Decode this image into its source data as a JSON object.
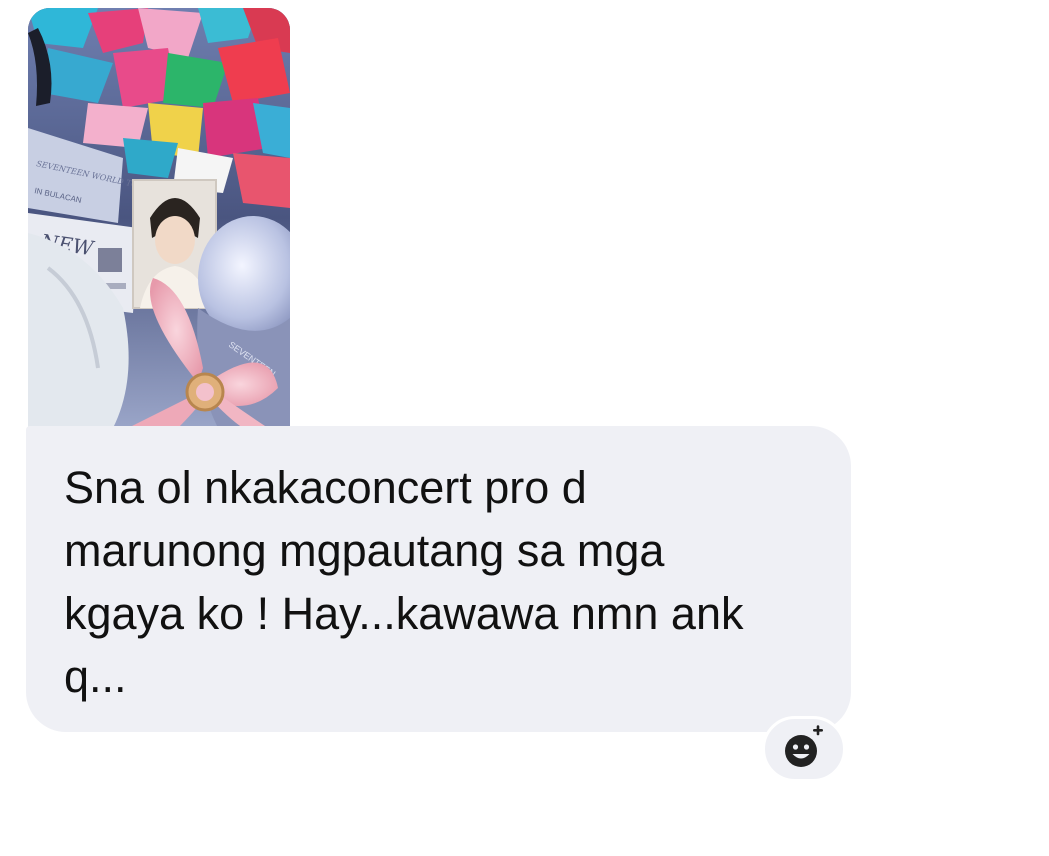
{
  "message": {
    "text": "Sna ol nkakaconcert pro d\nmarunong mgpautang sa mga\nkgaya ko ! Hay...kawawa nmn ank\nq...",
    "bubble_color": "#eff0f5",
    "text_color": "#111111"
  },
  "attachment": {
    "type": "photo",
    "printed_text": [
      "SEVENTEEN WORLD TOUR",
      "IN BULACAN",
      "NEW",
      "SEVENTEEN"
    ]
  },
  "reaction_button": {
    "icon": "add-reaction-smiley-icon",
    "color": "#222222"
  }
}
